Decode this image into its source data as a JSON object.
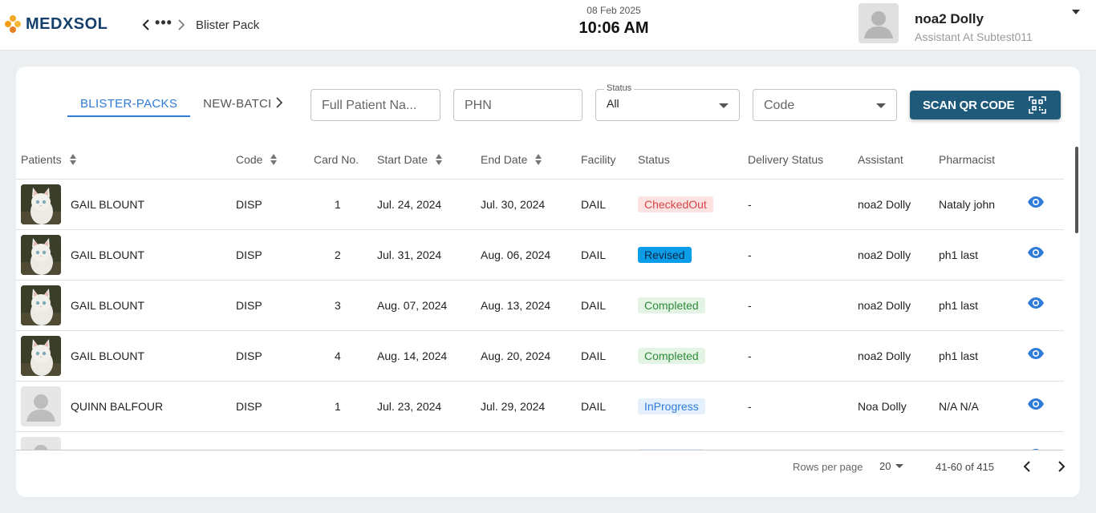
{
  "header": {
    "logo_text": "MEDXSOL",
    "breadcrumb_ellipsis": "•••",
    "breadcrumb_current": "Blister Pack",
    "date": "08 Feb 2025",
    "time": "10:06 AM",
    "user_name": "noa2 Dolly",
    "user_role": "Assistant At Subtest011"
  },
  "tabs": [
    {
      "label": "BLISTER-PACKS",
      "active": true
    },
    {
      "label": "NEW-BATCH",
      "active": false
    }
  ],
  "filters": {
    "patient_placeholder": "Full Patient Na...",
    "phn_placeholder": "PHN",
    "status_legend": "Status",
    "status_value": "All",
    "code_placeholder": "Code",
    "scan_label": "SCAN QR CODE"
  },
  "columns": {
    "patients": "Patients",
    "code": "Code",
    "card_no": "Card No.",
    "start_date": "Start Date",
    "end_date": "End Date",
    "facility": "Facility",
    "status": "Status",
    "delivery_status": "Delivery Status",
    "assistant": "Assistant",
    "pharmacist": "Pharmacist"
  },
  "rows": [
    {
      "patient": "GAIL BLOUNT",
      "avatar": "cat-photo",
      "code": "DISP",
      "card_no": "1",
      "start_date": "Jul. 24, 2024",
      "end_date": "Jul. 30, 2024",
      "facility": "DAIL",
      "status": "CheckedOut",
      "delivery_status": "-",
      "assistant": "noa2 Dolly",
      "pharmacist": "Nataly john"
    },
    {
      "patient": "GAIL BLOUNT",
      "avatar": "cat-photo",
      "code": "DISP",
      "card_no": "2",
      "start_date": "Jul. 31, 2024",
      "end_date": "Aug. 06, 2024",
      "facility": "DAIL",
      "status": "Revised",
      "delivery_status": "-",
      "assistant": "noa2 Dolly",
      "pharmacist": "ph1 last"
    },
    {
      "patient": "GAIL BLOUNT",
      "avatar": "cat-photo",
      "code": "DISP",
      "card_no": "3",
      "start_date": "Aug. 07, 2024",
      "end_date": "Aug. 13, 2024",
      "facility": "DAIL",
      "status": "Completed",
      "delivery_status": "-",
      "assistant": "noa2 Dolly",
      "pharmacist": "ph1 last"
    },
    {
      "patient": "GAIL BLOUNT",
      "avatar": "cat-photo",
      "code": "DISP",
      "card_no": "4",
      "start_date": "Aug. 14, 2024",
      "end_date": "Aug. 20, 2024",
      "facility": "DAIL",
      "status": "Completed",
      "delivery_status": "-",
      "assistant": "noa2 Dolly",
      "pharmacist": "ph1 last"
    },
    {
      "patient": "QUINN BALFOUR",
      "avatar": "placeholder",
      "code": "DISP",
      "card_no": "1",
      "start_date": "Jul. 23, 2024",
      "end_date": "Jul. 29, 2024",
      "facility": "DAIL",
      "status": "InProgress",
      "delivery_status": "-",
      "assistant": "Noa Dolly",
      "pharmacist": "N/A N/A"
    },
    {
      "patient": "",
      "avatar": "placeholder",
      "code": "",
      "card_no": "",
      "start_date": "",
      "end_date": "",
      "facility": "",
      "status": "InProgress",
      "delivery_status": "",
      "assistant": "",
      "pharmacist": ""
    }
  ],
  "status_colors": {
    "CheckedOut": {
      "bg": "#fde2e2",
      "fg": "#d64545"
    },
    "Revised": {
      "bg": "#0b9de8",
      "fg": "#0d2a4a"
    },
    "Completed": {
      "bg": "#e3f4e4",
      "fg": "#2f8a3a"
    },
    "InProgress": {
      "bg": "#e4f1fd",
      "fg": "#2f7bd8"
    }
  },
  "pagination": {
    "rows_per_page_label": "Rows per page",
    "rows_per_page_value": "20",
    "range": "41-60 of 415"
  },
  "colors": {
    "brand": "#14406b",
    "accent": "#2f7bd8",
    "scan_button": "#1f5a7a",
    "eye_icon": "#2f7bd8"
  }
}
